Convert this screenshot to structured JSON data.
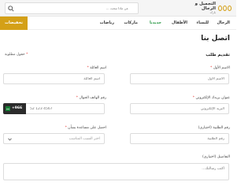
{
  "header": {
    "logo_line1": "التجميل و الرجال",
    "logo_line2": "بارك",
    "search_placeholder": "عن ماذا تبحث ..."
  },
  "nav": {
    "items": [
      "الرجال",
      "للنساء",
      "الأطفال",
      "جديدنا",
      "ماركات",
      "رياضات"
    ],
    "cta": "تخفيضات"
  },
  "page": {
    "title": "اتصل بنا",
    "section": "تقديم طلب",
    "required_note": "حقول مطلوبة",
    "required_mark": "*"
  },
  "form": {
    "first_name": {
      "label": "الاسم الأول",
      "placeholder": "الاسم الأول"
    },
    "last_name": {
      "label": "اسم العائلة",
      "placeholder": "اسم العائلة"
    },
    "email": {
      "label": "عنوان بريدك الإلكتروني",
      "placeholder": "البريد الإلكتروني"
    },
    "phone": {
      "label": "رقم الهاتف الجوال",
      "prefix": "+966",
      "placeholder": "52 123 4567"
    },
    "order_number": {
      "label": "رقم الطلبية (اختياري)",
      "placeholder": "رقم الطلبية"
    },
    "reason": {
      "label": "احصل على مساعدة بشأن",
      "value": "اختر السبب المناسب"
    },
    "details": {
      "label": "التفاصيل (اختياري)",
      "placeholder": "اكتب رسالتك..."
    }
  },
  "colors": {
    "accent": "#d4a017",
    "new": "#2e9b48",
    "required": "#e53935"
  }
}
